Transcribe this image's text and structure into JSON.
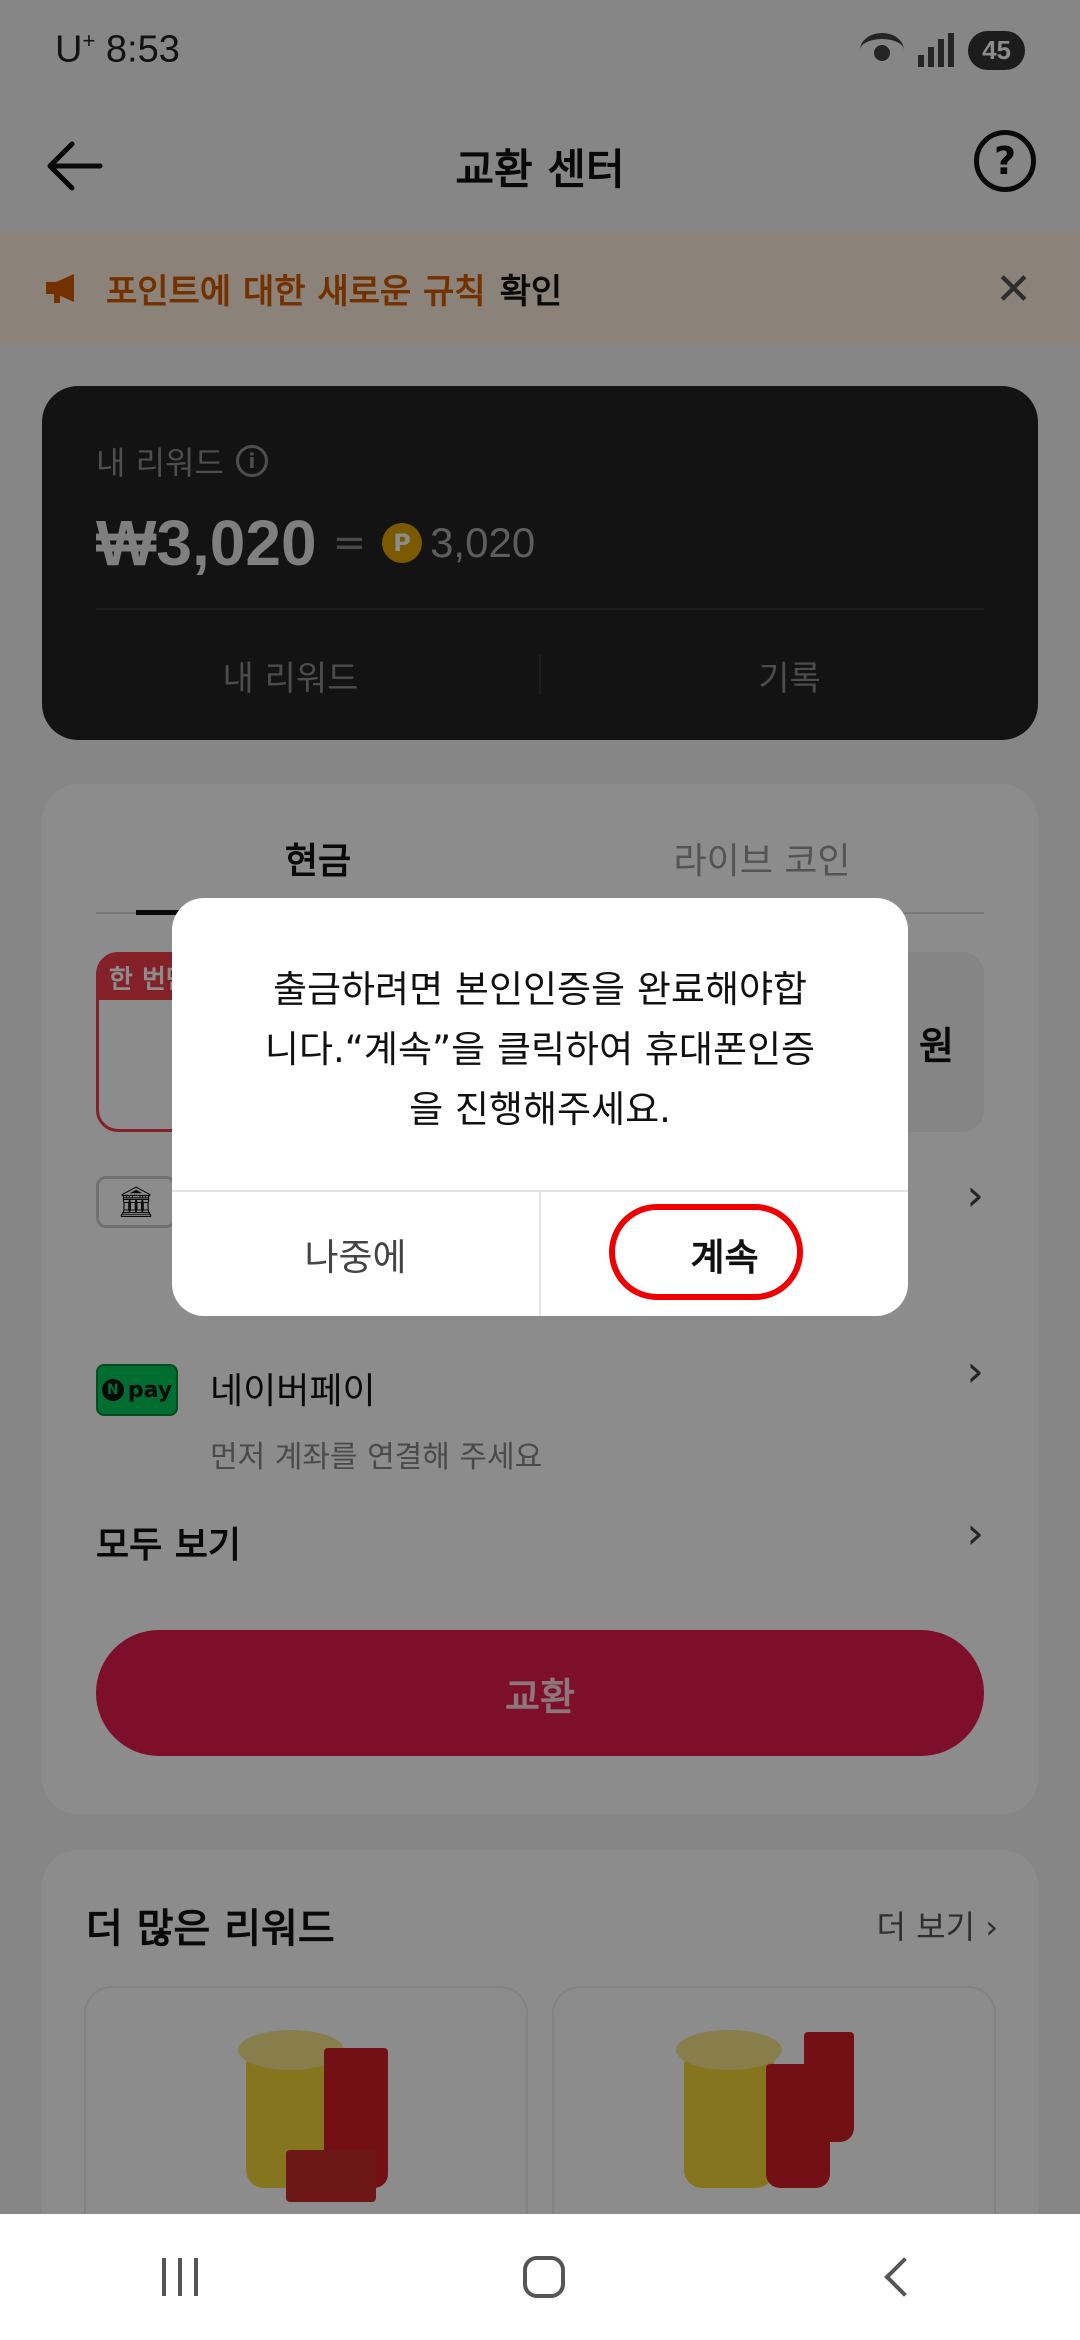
{
  "status_bar": {
    "carrier": "U",
    "carrier_sup": "+",
    "time": "8:53",
    "battery": "45"
  },
  "header": {
    "title": "교환 센터"
  },
  "notice": {
    "highlight": "포인트에 대한 새로운 규칙",
    "action": "확인"
  },
  "reward": {
    "label": "내 리워드",
    "amount_won": "₩3,020",
    "equals": "=",
    "coin_symbol": "P",
    "points": "3,020",
    "tabs": [
      "내 리워드",
      "기록"
    ]
  },
  "exchange": {
    "tabs": [
      "현금",
      "라이브 코인"
    ],
    "promo_badge": "한 번만",
    "promo_right_text": "원",
    "npay": {
      "logo_n": "N",
      "logo_text": "pay",
      "name": "네이버페이",
      "subtitle": "먼저 계좌를 연결해 주세요"
    },
    "see_all": "모두 보기",
    "button": "교환"
  },
  "more_rewards": {
    "title": "더 많은 리워드",
    "link": "더 보기 ›"
  },
  "dialog": {
    "line1": "출금하려면 본인인증을 완료해야합",
    "line2": "니다.“계속”을 클릭하여 휴대폰인증",
    "line3": "을 진행해주세요.",
    "cancel": "나중에",
    "confirm": "계속"
  },
  "colors": {
    "accent": "#e51c4d",
    "notice_text": "#d25a00",
    "highlight_ring": "#ee0000"
  }
}
